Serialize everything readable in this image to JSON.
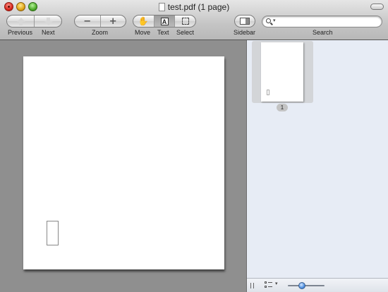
{
  "window": {
    "title": "test.pdf (1 page)"
  },
  "toolbar": {
    "previous_label": "Previous",
    "next_label": "Next",
    "zoom_label": "Zoom",
    "zoom_out_glyph": "−",
    "zoom_in_glyph": "+",
    "move_label": "Move",
    "text_label": "Text",
    "select_label": "Select",
    "text_tool_glyph": "A",
    "hand_glyph": "✋",
    "sidebar_label": "Sidebar",
    "search_label": "Search",
    "search_caret": "▾",
    "active_tool": "text"
  },
  "search": {
    "value": "",
    "placeholder": ""
  },
  "sidebar": {
    "thumbnails": [
      {
        "page_number": "1",
        "selected": true
      }
    ],
    "view_options_caret": "▾",
    "thumbnail_size": 0.35
  },
  "colors": {
    "content_background": "#8f8f8f",
    "sidebar_background": "#e7ecf5",
    "slider_knob": "#4f8fe0"
  },
  "icons": [
    "close-icon",
    "minimize-icon",
    "zoom-icon",
    "document-icon",
    "previous-arrow-icon",
    "next-arrow-icon",
    "zoom-out-icon",
    "zoom-in-icon",
    "hand-icon",
    "text-select-icon",
    "marquee-select-icon",
    "sidebar-icon",
    "search-icon",
    "resize-grip-icon",
    "view-options-icon"
  ]
}
